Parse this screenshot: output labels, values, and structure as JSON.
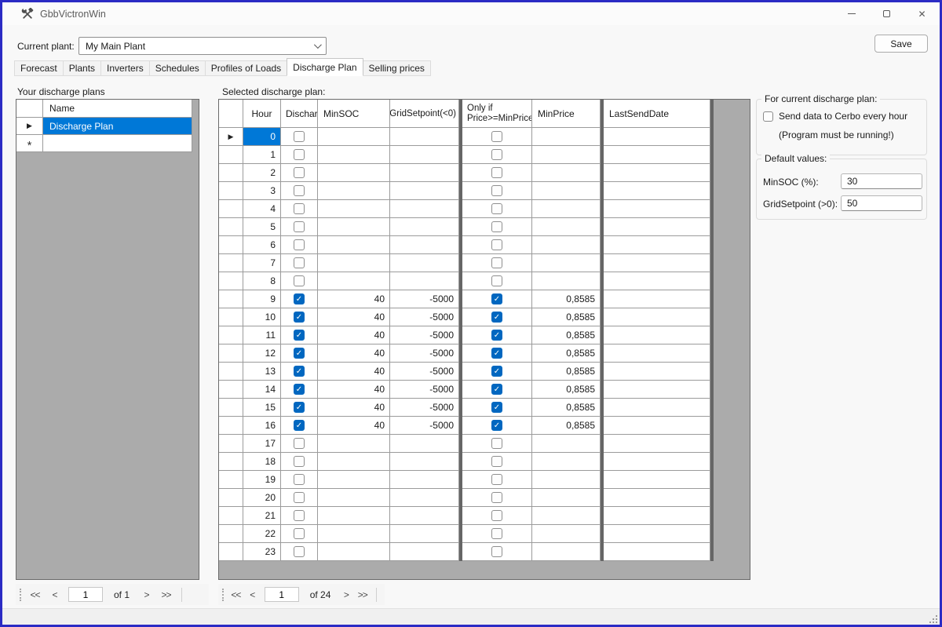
{
  "window": {
    "title": "GbbVictronWin"
  },
  "icons": {
    "close": "✕",
    "row_selector": "▶",
    "new_row": "*",
    "check": "✓"
  },
  "topbar": {
    "current_plant_label": "Current plant:",
    "current_plant_value": "My Main Plant",
    "save_label": "Save"
  },
  "tabs": [
    {
      "label": "Forecast",
      "active": false
    },
    {
      "label": "Plants",
      "active": false
    },
    {
      "label": "Inverters",
      "active": false
    },
    {
      "label": "Schedules",
      "active": false
    },
    {
      "label": "Profiles of Loads",
      "active": false
    },
    {
      "label": "Discharge Plan",
      "active": true
    },
    {
      "label": "Selling prices",
      "active": false
    }
  ],
  "plans_panel": {
    "heading": "Your discharge plans",
    "name_header": "Name",
    "rows": [
      {
        "name": "Discharge Plan",
        "selected": true
      }
    ]
  },
  "main_panel": {
    "heading": "Selected discharge plan:"
  },
  "main_grid": {
    "columns": {
      "hour": "Hour",
      "discharge": "Discharge",
      "minsoc": "MinSOC",
      "gridsetpoint": "GridSetpoint(<0)",
      "onlyif_line1": "Only if",
      "onlyif_line2": "Price>=MinPrice",
      "minprice": "MinPrice",
      "lastsenddate": "LastSendDate"
    },
    "selected_row": 0,
    "rows": [
      {
        "hour": "0",
        "discharge": false,
        "minsoc": "",
        "gridsetpoint": "",
        "onlyif": false,
        "minprice": "",
        "lastsenddate": ""
      },
      {
        "hour": "1",
        "discharge": false,
        "minsoc": "",
        "gridsetpoint": "",
        "onlyif": false,
        "minprice": "",
        "lastsenddate": ""
      },
      {
        "hour": "2",
        "discharge": false,
        "minsoc": "",
        "gridsetpoint": "",
        "onlyif": false,
        "minprice": "",
        "lastsenddate": ""
      },
      {
        "hour": "3",
        "discharge": false,
        "minsoc": "",
        "gridsetpoint": "",
        "onlyif": false,
        "minprice": "",
        "lastsenddate": ""
      },
      {
        "hour": "4",
        "discharge": false,
        "minsoc": "",
        "gridsetpoint": "",
        "onlyif": false,
        "minprice": "",
        "lastsenddate": ""
      },
      {
        "hour": "5",
        "discharge": false,
        "minsoc": "",
        "gridsetpoint": "",
        "onlyif": false,
        "minprice": "",
        "lastsenddate": ""
      },
      {
        "hour": "6",
        "discharge": false,
        "minsoc": "",
        "gridsetpoint": "",
        "onlyif": false,
        "minprice": "",
        "lastsenddate": ""
      },
      {
        "hour": "7",
        "discharge": false,
        "minsoc": "",
        "gridsetpoint": "",
        "onlyif": false,
        "minprice": "",
        "lastsenddate": ""
      },
      {
        "hour": "8",
        "discharge": false,
        "minsoc": "",
        "gridsetpoint": "",
        "onlyif": false,
        "minprice": "",
        "lastsenddate": ""
      },
      {
        "hour": "9",
        "discharge": true,
        "minsoc": "40",
        "gridsetpoint": "-5000",
        "onlyif": true,
        "minprice": "0,8585",
        "lastsenddate": ""
      },
      {
        "hour": "10",
        "discharge": true,
        "minsoc": "40",
        "gridsetpoint": "-5000",
        "onlyif": true,
        "minprice": "0,8585",
        "lastsenddate": ""
      },
      {
        "hour": "11",
        "discharge": true,
        "minsoc": "40",
        "gridsetpoint": "-5000",
        "onlyif": true,
        "minprice": "0,8585",
        "lastsenddate": ""
      },
      {
        "hour": "12",
        "discharge": true,
        "minsoc": "40",
        "gridsetpoint": "-5000",
        "onlyif": true,
        "minprice": "0,8585",
        "lastsenddate": ""
      },
      {
        "hour": "13",
        "discharge": true,
        "minsoc": "40",
        "gridsetpoint": "-5000",
        "onlyif": true,
        "minprice": "0,8585",
        "lastsenddate": ""
      },
      {
        "hour": "14",
        "discharge": true,
        "minsoc": "40",
        "gridsetpoint": "-5000",
        "onlyif": true,
        "minprice": "0,8585",
        "lastsenddate": ""
      },
      {
        "hour": "15",
        "discharge": true,
        "minsoc": "40",
        "gridsetpoint": "-5000",
        "onlyif": true,
        "minprice": "0,8585",
        "lastsenddate": ""
      },
      {
        "hour": "16",
        "discharge": true,
        "minsoc": "40",
        "gridsetpoint": "-5000",
        "onlyif": true,
        "minprice": "0,8585",
        "lastsenddate": ""
      },
      {
        "hour": "17",
        "discharge": false,
        "minsoc": "",
        "gridsetpoint": "",
        "onlyif": false,
        "minprice": "",
        "lastsenddate": ""
      },
      {
        "hour": "18",
        "discharge": false,
        "minsoc": "",
        "gridsetpoint": "",
        "onlyif": false,
        "minprice": "",
        "lastsenddate": ""
      },
      {
        "hour": "19",
        "discharge": false,
        "minsoc": "",
        "gridsetpoint": "",
        "onlyif": false,
        "minprice": "",
        "lastsenddate": ""
      },
      {
        "hour": "20",
        "discharge": false,
        "minsoc": "",
        "gridsetpoint": "",
        "onlyif": false,
        "minprice": "",
        "lastsenddate": ""
      },
      {
        "hour": "21",
        "discharge": false,
        "minsoc": "",
        "gridsetpoint": "",
        "onlyif": false,
        "minprice": "",
        "lastsenddate": ""
      },
      {
        "hour": "22",
        "discharge": false,
        "minsoc": "",
        "gridsetpoint": "",
        "onlyif": false,
        "minprice": "",
        "lastsenddate": ""
      },
      {
        "hour": "23",
        "discharge": false,
        "minsoc": "",
        "gridsetpoint": "",
        "onlyif": false,
        "minprice": "",
        "lastsenddate": ""
      }
    ]
  },
  "right_panel": {
    "group1": {
      "title": "For current discharge plan:",
      "checkbox_label": "Send data to Cerbo every hour",
      "checkbox_checked": false,
      "note": "(Program must be running!)"
    },
    "group2": {
      "title": "Default values:",
      "minsoc_label": "MinSOC (%):",
      "minsoc_value": "30",
      "gridsetpoint_label": "GridSetpoint (>0):",
      "gridsetpoint_value": "50"
    }
  },
  "navigators": {
    "plans": {
      "first": "<<",
      "prev": "<",
      "position": "1",
      "count": "of 1",
      "next": ">",
      "last": ">>"
    },
    "hours": {
      "first": "<<",
      "prev": "<",
      "position": "1",
      "count": "of 24",
      "next": ">",
      "last": ">>"
    }
  },
  "colors": {
    "selection": "#0078d7",
    "checkbox_checked": "#0067c0",
    "window_border": "#2b2bc4",
    "grid_background": "#ababab"
  }
}
